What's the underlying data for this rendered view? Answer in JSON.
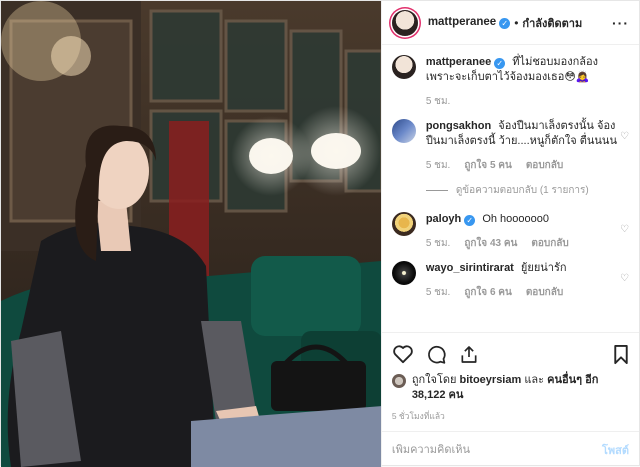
{
  "header": {
    "username": "mattperanee",
    "verified_mark": "✓",
    "separator": "•",
    "follow_label": "กำลังติดตาม",
    "more_icon": "more-icon"
  },
  "caption": {
    "username": "mattperanee",
    "verified_mark": "✓",
    "text": "ที่ไม่ชอบมองกล้อง เพราะจะเก็บตาไว้จ้องมองเธอ😳🙇‍♀️",
    "time": "5 ชม."
  },
  "comments": [
    {
      "username": "pongsakhon",
      "text": "จ้องปืนมาเล็งตรงนั้น จ้องปืนมาเล็งตรงนี้ ว้าย....หนูก็ตักใจ ตื่นนนน",
      "time": "5 ชม.",
      "likes": "ถูกใจ 5 คน",
      "reply": "ตอบกลับ",
      "view_replies": "ดูข้อความตอบกลับ (1 รายการ)"
    },
    {
      "username": "paloyh",
      "verified_mark": "✓",
      "text": "Oh hoooooo0",
      "time": "5 ชม.",
      "likes": "ถูกใจ 43 คน",
      "reply": "ตอบกลับ"
    },
    {
      "username": "wayo_sirintirarat",
      "text": "ยู้ยยน่ารัก",
      "time": "5 ชม.",
      "likes": "ถูกใจ 6 คน",
      "reply": "ตอบกลับ"
    }
  ],
  "likes": {
    "prefix": "ถูกใจโดย",
    "user": "bitoeyrsiam",
    "and": "และ",
    "others": "คนอื่นๆ อีก 38,122 คน"
  },
  "posted_time": "5 ชั่วโมงที่แล้ว",
  "add_comment": {
    "placeholder": "เพิ่มความคิดเห็น",
    "post_label": "โพสต์"
  },
  "colors": {
    "link_blue": "#3897f0",
    "post_button_disabled": "#b3dbff",
    "story_ring": "#e1306c"
  }
}
